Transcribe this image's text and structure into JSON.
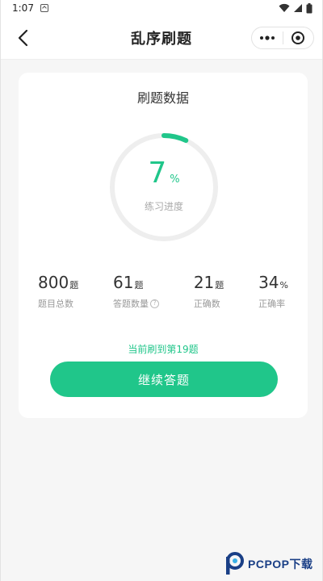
{
  "status_bar": {
    "time": "1:07"
  },
  "nav": {
    "title": "乱序刷题"
  },
  "card": {
    "title": "刷题数据",
    "progress": {
      "percent": 7,
      "unit": "%",
      "label": "练习进度"
    },
    "stats": [
      {
        "value": "800",
        "unit": "题",
        "label": "题目总数"
      },
      {
        "value": "61",
        "unit": "题",
        "label": "答题数量"
      },
      {
        "value": "21",
        "unit": "题",
        "label": "正确数"
      },
      {
        "value": "34",
        "unit": "%",
        "label": "正确率"
      }
    ],
    "current_text": "当前刷到第19题",
    "continue_label": "继续答题"
  },
  "colors": {
    "accent": "#20c68a",
    "ring_track": "#eeeeee"
  },
  "watermark": {
    "text": "PCPOP下载"
  }
}
